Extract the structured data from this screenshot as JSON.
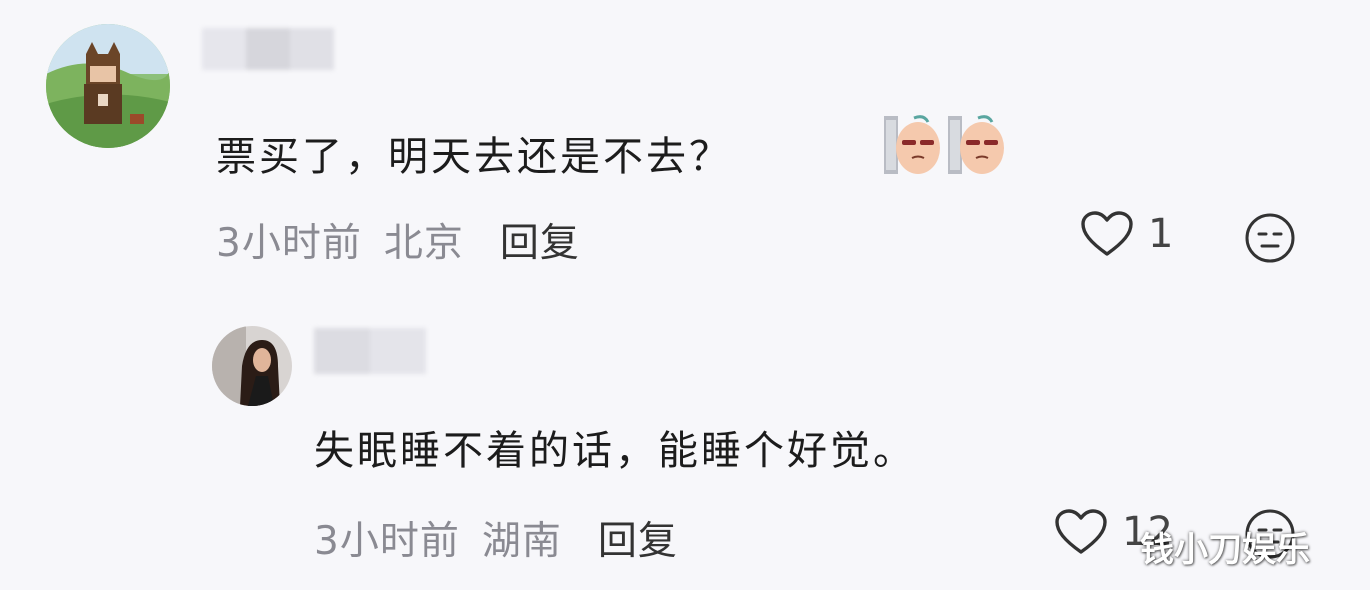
{
  "comments": [
    {
      "text": "票买了，明天去还是不去？",
      "emoji_count": 2,
      "time": "3小时前",
      "location": "北京",
      "reply_label": "回复",
      "likes": "1"
    }
  ],
  "replies": [
    {
      "text": "失眠睡不着的话，能睡个好觉。",
      "time": "3小时前",
      "location": "湖南",
      "reply_label": "回复",
      "likes": "12"
    }
  ],
  "watermark": "钱小刀娱乐",
  "icons": {
    "like": "heart-outline-icon",
    "react": "neutral-face-icon",
    "emoji": "peeking-face-sticker-icon"
  },
  "colors": {
    "background": "#f7f7fa",
    "meta_text": "#8a8a92",
    "body_text": "#1c1c1c"
  }
}
